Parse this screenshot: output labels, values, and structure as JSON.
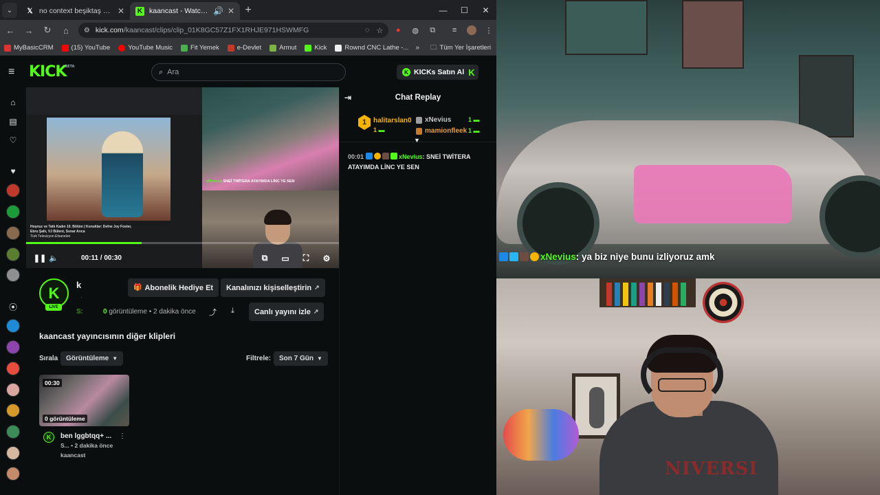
{
  "browser": {
    "tabs": [
      {
        "title": "no context beşiktaş on X: \"kaç p",
        "active": false,
        "favicon": "x-logo-icon"
      },
      {
        "title": "kaancast - Watch clips on K",
        "active": true,
        "favicon": "kick-icon",
        "audio": "speaker-icon"
      }
    ],
    "url_host": "kick.com",
    "url_path": "/kaancast/clips/clip_01K8GC57Z1FX1RHJE971HSWMFG",
    "bookmarks": [
      "MyBasicCRM",
      "(15) YouTube",
      "YouTube Music",
      "Fit Yemek",
      "e-Devlet",
      "Armut",
      "Kick",
      "Rownd CNC Lathe -..."
    ],
    "all_bookmarks": "Tüm Yer İşaretleri"
  },
  "kick": {
    "logo": "KICK",
    "logo_beta": "BETA",
    "search_placeholder": "Ara",
    "kicks_button": "KICKs Satın Al"
  },
  "video": {
    "current_time": "00:11",
    "duration": "00:30",
    "progress_fraction": 0.37,
    "stream_chat_user": "xNevius",
    "stream_chat_text": ": SNEİ TWİTERA ATAYIMDA LİNC YE SEN",
    "yt_title": "Hoşnuz ve Tatlı Kadın 10. Bölüm | Konuklar: Defne Joy Foster, Ebru Şallı, VJ Bülent, Sonar Arıca",
    "yt_channel": "Türk Televizyon Efsaneleri"
  },
  "chat": {
    "title": "Chat Replay",
    "top_gifter": {
      "rank": "1",
      "name": "halitarslan0",
      "count": "1"
    },
    "gifters": [
      {
        "name": "xNevius",
        "count": "1"
      },
      {
        "name": "mamionfleek",
        "count": "1"
      }
    ],
    "messages": [
      {
        "time": "00:01",
        "user": "xNevius",
        "text": ": SNEİ TWİTERA ATAYIMDA LİNC YE SEN"
      }
    ]
  },
  "clip": {
    "title": "k",
    "streamer_short": "S:",
    "views_count": "0",
    "views_label": "görüntüleme",
    "ago": "• 2 dakika önce",
    "gift_button": "Abonelik Hediye Et",
    "customize_button": "Kanalınızı kişiselleştirin",
    "watch_live_button": "Canlı yayını izle",
    "live_badge": "LIVE"
  },
  "others": {
    "title": "kaancast yayıncısının diğer klipleri",
    "sort_label": "Sırala",
    "sort_value": "Görüntüleme",
    "filter_label": "Filtrele:",
    "filter_value": "Son 7 Gün",
    "cards": [
      {
        "duration": "00:30",
        "views": "0 görüntüleme",
        "title": "ben lggbtqq+ ...",
        "sub": "S... • 2 dakika önce",
        "channel": "kaancast"
      }
    ]
  },
  "stream_overlay": {
    "user": "xNevius",
    "text": ": ya biz niye bunu izliyoruz amk",
    "hoodie_text": "NIVERSI"
  },
  "colors": {
    "kick_green": "#53fc18",
    "gold": "#f5b400",
    "bg": "#0b0e0f"
  }
}
